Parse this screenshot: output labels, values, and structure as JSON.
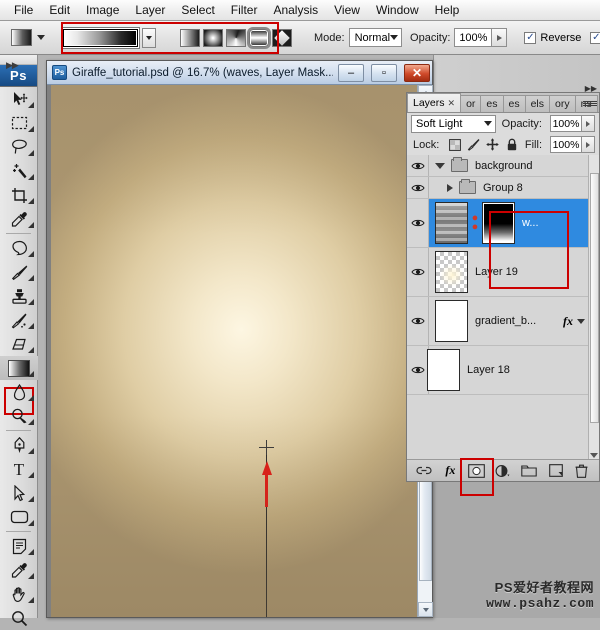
{
  "app": {
    "name": "Adobe Photoshop",
    "ps_badge": "Ps"
  },
  "menubar": {
    "items": [
      {
        "label": "File",
        "name": "menu-file"
      },
      {
        "label": "Edit",
        "name": "menu-edit"
      },
      {
        "label": "Image",
        "name": "menu-image"
      },
      {
        "label": "Layer",
        "name": "menu-layer"
      },
      {
        "label": "Select",
        "name": "menu-select"
      },
      {
        "label": "Filter",
        "name": "menu-filter"
      },
      {
        "label": "Analysis",
        "name": "menu-analysis"
      },
      {
        "label": "View",
        "name": "menu-view"
      },
      {
        "label": "Window",
        "name": "menu-window"
      },
      {
        "label": "Help",
        "name": "menu-help"
      }
    ]
  },
  "options_bar": {
    "tool": "gradient-tool",
    "gradient_preset_label": "Black, White",
    "gradient_types": [
      {
        "label": "Linear Gradient",
        "name": "gradient-type-linear",
        "selected": false
      },
      {
        "label": "Radial Gradient",
        "name": "gradient-type-radial",
        "selected": false
      },
      {
        "label": "Angle Gradient",
        "name": "gradient-type-angle",
        "selected": false
      },
      {
        "label": "Reflected Gradient",
        "name": "gradient-type-reflected",
        "selected": true
      },
      {
        "label": "Diamond Gradient",
        "name": "gradient-type-diamond",
        "selected": false
      }
    ],
    "mode_label": "Mode:",
    "mode_value": "Normal",
    "opacity_label": "Opacity:",
    "opacity_value": "100%",
    "reverse_label": "Reverse",
    "reverse_checked": true,
    "dither_checked": true,
    "highlight_color": "#cc0000"
  },
  "toolbar": {
    "tools": [
      {
        "name": "move-tool",
        "label": "Move Tool",
        "active": false
      },
      {
        "name": "rectangular-marquee-tool",
        "label": "Rectangular Marquee Tool",
        "active": false
      },
      {
        "name": "lasso-tool",
        "label": "Lasso Tool",
        "active": false
      },
      {
        "name": "magic-wand-tool",
        "label": "Magic Wand Tool",
        "active": false
      },
      {
        "name": "crop-tool",
        "label": "Crop Tool",
        "active": false
      },
      {
        "name": "eyedropper-tool",
        "label": "Eyedropper Tool",
        "active": false
      },
      {
        "name": "healing-brush-tool",
        "label": "Spot Healing Brush Tool",
        "active": false
      },
      {
        "name": "brush-tool",
        "label": "Brush Tool",
        "active": false
      },
      {
        "name": "clone-stamp-tool",
        "label": "Clone Stamp Tool",
        "active": false
      },
      {
        "name": "history-brush-tool",
        "label": "History Brush Tool",
        "active": false
      },
      {
        "name": "eraser-tool",
        "label": "Eraser Tool",
        "active": false
      },
      {
        "name": "gradient-tool",
        "label": "Gradient Tool",
        "active": true
      },
      {
        "name": "blur-tool",
        "label": "Blur Tool",
        "active": false
      },
      {
        "name": "dodge-tool",
        "label": "Dodge Tool",
        "active": false
      },
      {
        "name": "pen-tool",
        "label": "Pen Tool",
        "active": false
      },
      {
        "name": "horizontal-type-tool",
        "label": "Horizontal Type Tool",
        "active": false
      },
      {
        "name": "path-selection-tool",
        "label": "Path Selection Tool",
        "active": false
      },
      {
        "name": "rectangle-shape-tool",
        "label": "Rectangle Tool",
        "active": false
      },
      {
        "name": "note-tool",
        "label": "Note Tool",
        "active": false
      },
      {
        "name": "color-sampler-tool",
        "label": "Color Sampler Tool",
        "active": false
      },
      {
        "name": "hand-tool",
        "label": "Hand Tool",
        "active": false
      },
      {
        "name": "zoom-tool",
        "label": "Zoom Tool",
        "active": false
      }
    ],
    "type_tool_glyph": "T"
  },
  "document": {
    "title": "Giraffe_tutorial.psd @ 16.7% (waves, Layer Mask...",
    "icon_label": "Ps",
    "zoom": "16.7%",
    "filename": "Giraffe_tutorial.psd",
    "layer_context": "waves, Layer Mask",
    "window_buttons": {
      "minimize": "–",
      "maximize": "▫",
      "close": "✕"
    },
    "annotation": {
      "arrow": "red-drag-direction-arrow",
      "start_marker": "red-cross-start-point",
      "description": "Gradient drag from bottom cross marker upward to crosshair cursor"
    }
  },
  "layers_panel": {
    "tabs": [
      {
        "label": "Layers",
        "name": "tab-layers",
        "active": true,
        "close": "✕"
      },
      {
        "label": "or",
        "name": "tab-color",
        "active": false
      },
      {
        "label": "es",
        "name": "tab-styles",
        "active": false
      },
      {
        "label": "es",
        "name": "tab-paths",
        "active": false
      },
      {
        "label": "els",
        "name": "tab-channels",
        "active": false
      },
      {
        "label": "ory",
        "name": "tab-history",
        "active": false
      },
      {
        "label": "ns",
        "name": "tab-actions",
        "active": false
      }
    ],
    "blend_mode": "Soft Light",
    "opacity_label": "Opacity:",
    "opacity_value": "100%",
    "lock_label": "Lock:",
    "fill_label": "Fill:",
    "fill_value": "100%",
    "lock_icons": [
      {
        "name": "lock-transparent-pixels-icon",
        "label": "Lock transparent pixels"
      },
      {
        "name": "lock-image-pixels-icon",
        "label": "Lock image pixels"
      },
      {
        "name": "lock-position-icon",
        "label": "Lock position"
      },
      {
        "name": "lock-all-icon",
        "label": "Lock all"
      }
    ],
    "layers": [
      {
        "name": "background",
        "kind": "group",
        "selected": false,
        "visible": true,
        "expanded": true,
        "thumb": "folder",
        "indent": 0
      },
      {
        "name": "Group 8",
        "kind": "group",
        "selected": false,
        "visible": true,
        "expanded": false,
        "thumb": "folder",
        "indent": 1
      },
      {
        "name": "w...",
        "full_name": "waves",
        "kind": "layer",
        "selected": true,
        "visible": true,
        "thumb": "waves",
        "mask": "gradient-mask",
        "indent": 1,
        "linked": true,
        "highlighted": true
      },
      {
        "name": "Layer 19",
        "kind": "layer",
        "selected": false,
        "visible": true,
        "thumb": "transparent-glow",
        "indent": 1
      },
      {
        "name": "gradient_b...",
        "kind": "layer",
        "selected": false,
        "visible": true,
        "thumb": "white",
        "fx": "fx",
        "indent": 1
      },
      {
        "name": "Layer 18",
        "kind": "layer",
        "selected": false,
        "visible": true,
        "thumb": "white",
        "indent": 0
      }
    ],
    "footer_buttons": [
      {
        "name": "link-layers-button",
        "label": "Link layers",
        "highlighted": false
      },
      {
        "name": "layer-style-button",
        "label": "Add a layer style",
        "glyph": "fx",
        "highlighted": false
      },
      {
        "name": "add-layer-mask-button",
        "label": "Add layer mask",
        "highlighted": true
      },
      {
        "name": "new-adjustment-layer-button",
        "label": "Create new fill or adjustment layer",
        "highlighted": false
      },
      {
        "name": "new-group-button",
        "label": "Create a new group",
        "highlighted": false
      },
      {
        "name": "new-layer-button",
        "label": "Create a new layer",
        "highlighted": false
      },
      {
        "name": "delete-layer-button",
        "label": "Delete layer",
        "highlighted": false
      }
    ]
  },
  "watermark": {
    "line1": "PS爱好者教程网",
    "line2": "www.psahz.com"
  }
}
